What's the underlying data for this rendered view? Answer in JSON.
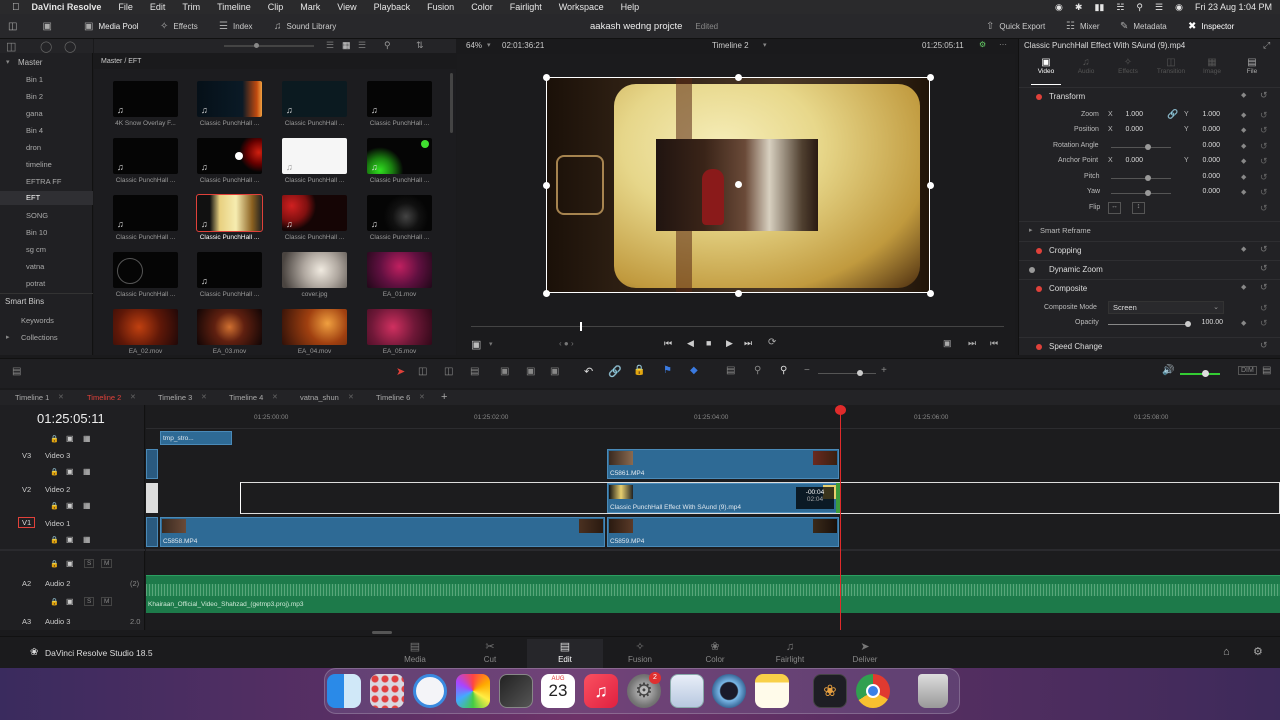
{
  "menubar": {
    "app_name": "DaVinci Resolve",
    "items": [
      "File",
      "Edit",
      "Trim",
      "Timeline",
      "Clip",
      "Mark",
      "View",
      "Playback",
      "Fusion",
      "Color",
      "Fairlight",
      "Workspace",
      "Help"
    ],
    "datetime": "Fri 23 Aug  1:04 PM"
  },
  "toolbar": {
    "media_pool": "Media Pool",
    "effects": "Effects",
    "index": "Index",
    "sound_library": "Sound Library",
    "project_name": "aakash wedng projcte",
    "project_status": "Edited",
    "quick_export": "Quick Export",
    "mixer": "Mixer",
    "metadata": "Metadata",
    "inspector": "Inspector"
  },
  "bins": {
    "master": "Master",
    "items": [
      "Bin 1",
      "Bin 2",
      "gana",
      "Bin 4",
      "dron",
      "timeline",
      "EFTRA FF",
      "EFT",
      "SONG",
      "Bin 10",
      "sg cm",
      "vatna",
      "potrat"
    ],
    "selected": "EFT",
    "smart_bins": "Smart Bins",
    "keywords": "Keywords",
    "collections": "Collections"
  },
  "media_pool": {
    "path": "Master / EFT",
    "clips": [
      "4K Snow Overlay F...",
      "Classic PunchHall ...",
      "Classic PunchHall ...",
      "Classic PunchHall ...",
      "Classic PunchHall ...",
      "Classic PunchHall ...",
      "Classic PunchHall ...",
      "Classic PunchHall ...",
      "Classic PunchHall ...",
      "Classic PunchHall ...",
      "Classic PunchHall ...",
      "Classic PunchHall ...",
      "Classic PunchHall ...",
      "Classic PunchHall ...",
      "cover.jpg",
      "EA_01.mov",
      "EA_02.mov",
      "EA_03.mov",
      "EA_04.mov",
      "EA_05.mov"
    ]
  },
  "viewer": {
    "zoom": "64%",
    "duration": "02:01:36:21",
    "timeline_name": "Timeline 2",
    "timecode": "01:25:05:11"
  },
  "inspector": {
    "clip_title": "Classic PunchHall Effect With SAund (9).mp4",
    "tabs": [
      "Video",
      "Audio",
      "Effects",
      "Transition",
      "Image",
      "File"
    ],
    "transform": "Transform",
    "zoom_label": "Zoom",
    "zoom_x": "1.000",
    "zoom_y": "1.000",
    "position_label": "Position",
    "position_x": "0.000",
    "position_y": "0.000",
    "rotation_label": "Rotation Angle",
    "rotation": "0.000",
    "anchor_label": "Anchor Point",
    "anchor_x": "0.000",
    "anchor_y": "0.000",
    "pitch_label": "Pitch",
    "pitch": "0.000",
    "yaw_label": "Yaw",
    "yaw": "0.000",
    "flip_label": "Flip",
    "smart_reframe": "Smart Reframe",
    "cropping": "Cropping",
    "dynamic_zoom": "Dynamic Zoom",
    "composite": "Composite",
    "composite_mode_label": "Composite Mode",
    "composite_mode": "Screen",
    "opacity_label": "Opacity",
    "opacity": "100.00",
    "speed_change": "Speed Change"
  },
  "timeline": {
    "tabs": [
      "Timeline 1",
      "Timeline 2",
      "Timeline 3",
      "Timeline 4",
      "vatna_shun",
      "Timeline 6"
    ],
    "active_tab": "Timeline 2",
    "timecode": "01:25:05:11",
    "ruler": [
      "01:25:00:00",
      "01:25:02:00",
      "01:25:04:00",
      "01:25:06:00",
      "01:25:08:00"
    ],
    "tracks": {
      "v3_id": "V3",
      "v3_name": "Video 3",
      "v2_id": "V2",
      "v2_name": "Video 2",
      "v1_id": "V1",
      "v1_name": "Video 1",
      "a2_id": "A2",
      "a2_name": "Audio 2",
      "a2_ch": "(2)",
      "a3_id": "A3",
      "a3_name": "Audio 3",
      "a3_ch": "2.0"
    },
    "clips": {
      "tmp": "tmp_stro...",
      "c5861": "C5861.MP4",
      "punch": "Classic PunchHall Effect With SAund (9).mp4",
      "trim_offset": "-00:04",
      "trim_len": "02:04",
      "c5858": "C5858.MP4",
      "c5859": "C5859.MP4",
      "audio": "Khairaan_Official_Video_Shahzad_(getmp3.proj).mp3"
    }
  },
  "pages": {
    "brand": "DaVinci Resolve Studio 18.5",
    "items": [
      "Media",
      "Cut",
      "Edit",
      "Fusion",
      "Color",
      "Fairlight",
      "Deliver"
    ],
    "active": "Edit"
  },
  "dock": {
    "calendar_month": "AUG",
    "calendar_day": "23",
    "settings_badge": "2"
  },
  "colors": {
    "accent_red": "#e0413a",
    "clip_blue": "#2e6a95",
    "audio_green": "#1d7a4a",
    "playhead": "#e02b2b"
  }
}
